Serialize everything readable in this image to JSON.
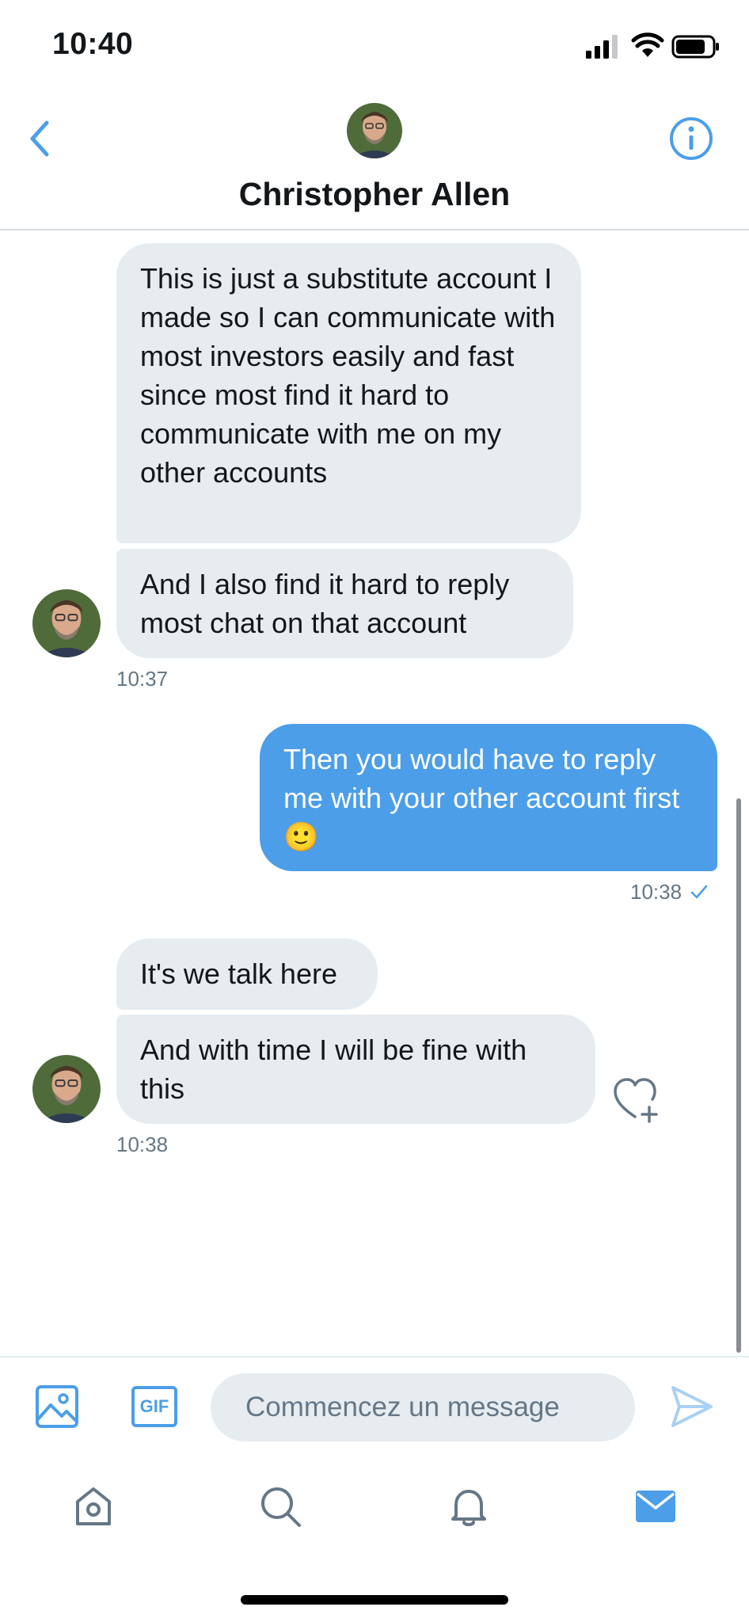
{
  "status_bar": {
    "time": "10:40"
  },
  "header": {
    "contact_name": "Christopher Allen"
  },
  "messages": [
    {
      "text": "This is just a substitute account I made so I can communicate with most investors easily and fast since most find it hard to communicate with me on my other accounts"
    },
    {
      "text": "And I also find it hard to reply most chat on that account"
    },
    {
      "time": "10:37"
    },
    {
      "text": "Then you would have to reply me with your other account first 🙂"
    },
    {
      "time": "10:38"
    },
    {
      "text": "It's we talk here"
    },
    {
      "text": "And with time I will be fine with this"
    },
    {
      "time": "10:38"
    }
  ],
  "composer": {
    "placeholder": "Commencez un message",
    "gif_label": "GIF"
  },
  "icons": {
    "back": "chevron-left-icon",
    "info": "info-icon",
    "media": "image-icon",
    "send": "send-icon",
    "heart": "heart-add-icon",
    "tabs": [
      "home-icon",
      "search-icon",
      "bell-icon",
      "mail-icon"
    ]
  },
  "colors": {
    "accent": "#4c9ee8",
    "received_bubble": "#e6ecf0",
    "text_secondary": "#657786"
  }
}
